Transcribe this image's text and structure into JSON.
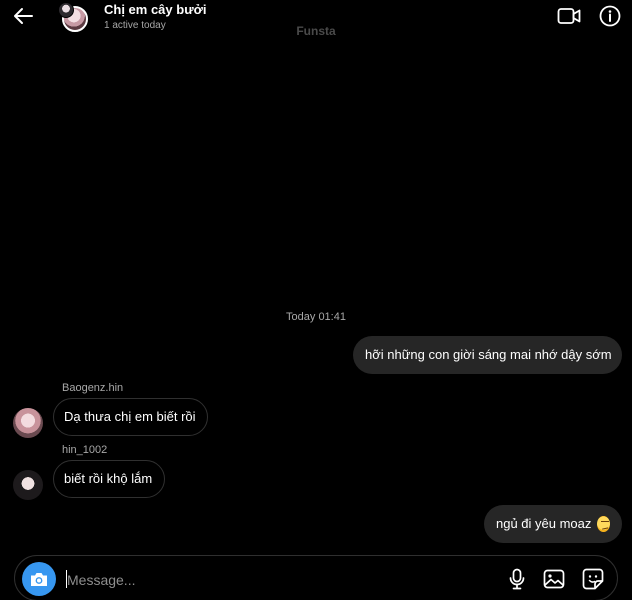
{
  "header": {
    "title": "Chị em cây bưởi",
    "subtitle": "1 active today",
    "account_name": "Funsta",
    "icons": {
      "back": "arrow-left-icon",
      "video": "video-camera-icon",
      "info": "info-icon"
    }
  },
  "conversation": {
    "timestamp": "Today 01:41",
    "messages": [
      {
        "direction": "outgoing",
        "text": "hỡi những con giời sáng mai nhớ dậy sớm"
      },
      {
        "direction": "incoming",
        "sender": "Baogenz.hin",
        "text": "Dạ thưa chị em biết rồi"
      },
      {
        "direction": "incoming",
        "sender": "hin_1002",
        "text": "biết rồi khộ lắm"
      },
      {
        "direction": "outgoing",
        "text": "ngủ đi yêu moaz",
        "emoji": "smirking-face"
      }
    ]
  },
  "composer": {
    "placeholder": "Message...",
    "value": "",
    "icons": {
      "camera": "camera-icon",
      "mic": "microphone-icon",
      "gallery": "image-icon",
      "sticker": "sticker-icon"
    }
  },
  "colors": {
    "background": "#000000",
    "outgoing_bubble": "#262626",
    "incoming_border": "#303030",
    "accent": "#3797f0",
    "muted_text": "#a8a8a8"
  }
}
